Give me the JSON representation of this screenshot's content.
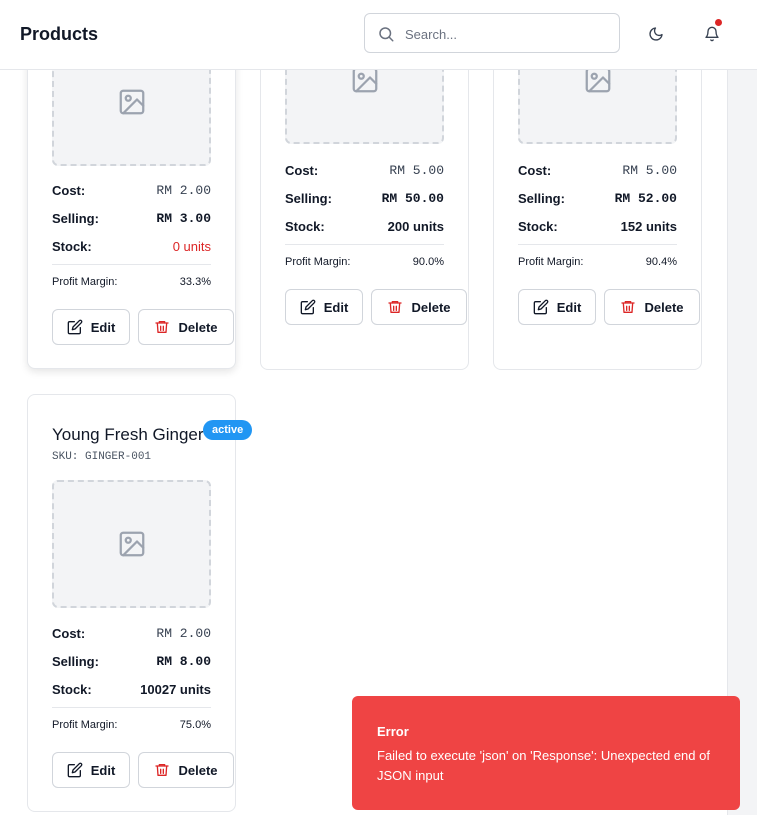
{
  "header": {
    "title": "Products",
    "search_placeholder": "Search...",
    "notification_dot": "#dc2626"
  },
  "colors": {
    "accent": "#2196f3",
    "danger": "#dc2626",
    "toast_bg": "#ef4444"
  },
  "cards": [
    {
      "name": "",
      "cost_label": "Cost:",
      "cost": "RM 2.00",
      "selling_label": "Selling:",
      "selling": "RM 3.00",
      "stock_label": "Stock:",
      "stock": "0 units",
      "margin_label": "Profit Margin:",
      "margin": "33.3%",
      "edit_label": "Edit",
      "delete_label": "Delete"
    },
    {
      "name": "",
      "cost_label": "Cost:",
      "cost": "RM 5.00",
      "selling_label": "Selling:",
      "selling": "RM 50.00",
      "stock_label": "Stock:",
      "stock": "200 units",
      "margin_label": "Profit Margin:",
      "margin": "90.0%",
      "edit_label": "Edit",
      "delete_label": "Delete"
    },
    {
      "name": "",
      "cost_label": "Cost:",
      "cost": "RM 5.00",
      "selling_label": "Selling:",
      "selling": "RM 52.00",
      "stock_label": "Stock:",
      "stock": "152 units",
      "margin_label": "Profit Margin:",
      "margin": "90.4%",
      "edit_label": "Edit",
      "delete_label": "Delete"
    },
    {
      "name": "Young Fresh Ginger",
      "sku": "SKU: GINGER-001",
      "status": "active",
      "cost_label": "Cost:",
      "cost": "RM 2.00",
      "selling_label": "Selling:",
      "selling": "RM 8.00",
      "stock_label": "Stock:",
      "stock": "10027 units",
      "margin_label": "Profit Margin:",
      "margin": "75.0%",
      "edit_label": "Edit",
      "delete_label": "Delete"
    }
  ],
  "toast": {
    "title": "Error",
    "message": "Failed to execute 'json' on 'Response': Unexpected end of JSON input"
  }
}
